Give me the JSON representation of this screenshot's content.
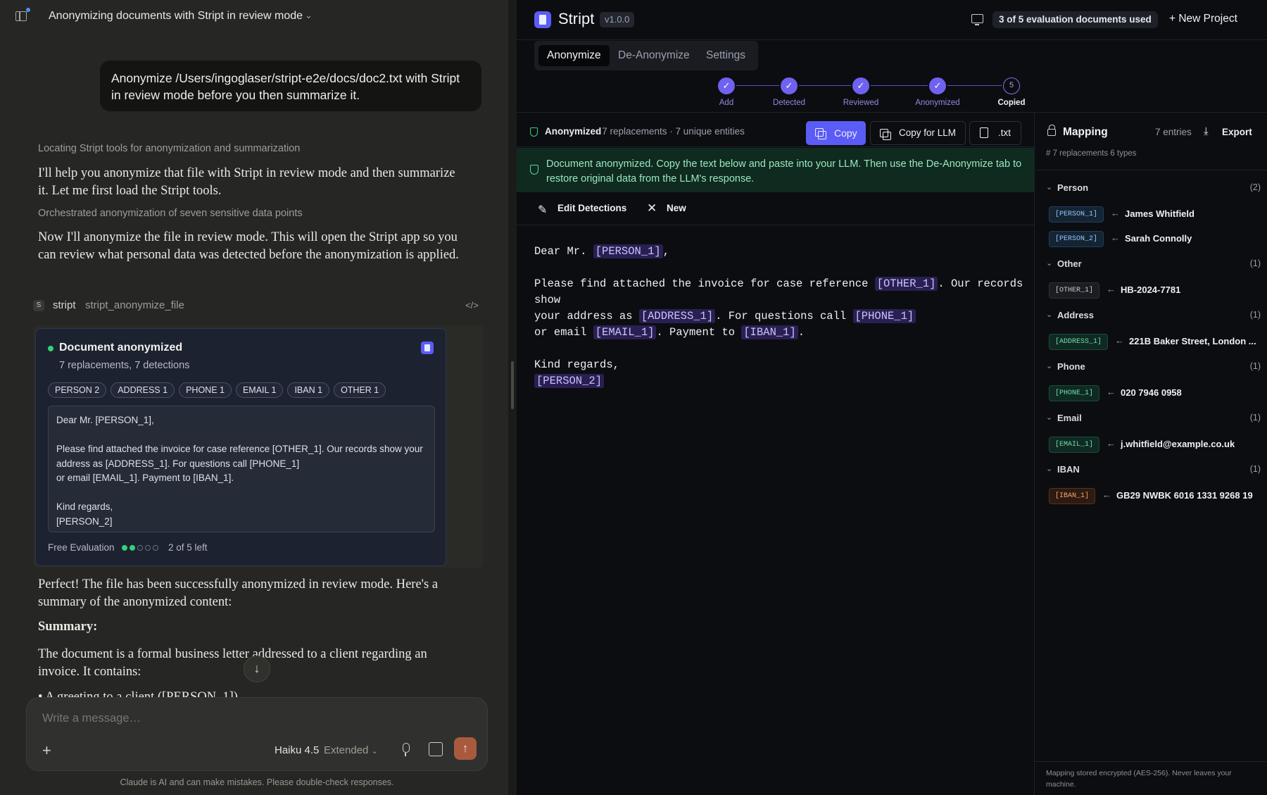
{
  "chat": {
    "title": "Anonymizing documents with Stript in review mode",
    "user_message": "Anonymize /Users/ingoglaser/stript-e2e/docs/doc2.txt with Stript in review mode before you then summarize it.",
    "meta1": "Locating Stript tools for anonymization and summarization",
    "para1": "I'll help you anonymize that file with Stript in review mode and then summarize it. Let me first load the Stript tools.",
    "meta2": "Orchestrated anonymization of seven sensitive data points",
    "para2": "Now I'll anonymize the file in review mode. This will open the Stript app so you can review what personal data was detected before the anonymization is applied.",
    "tool": {
      "badge": "S",
      "name": "stript",
      "function": "stript_anonymize_file",
      "code_icon": "</>"
    },
    "card": {
      "title": "Document anonymized",
      "subtitle": "7 replacements, 7 detections",
      "chips": [
        "PERSON 2",
        "ADDRESS 1",
        "PHONE 1",
        "EMAIL 1",
        "IBAN 1",
        "OTHER 1"
      ],
      "body": "Dear Mr. [PERSON_1],\n\nPlease find attached the invoice for case reference [OTHER_1]. Our records show your address as [ADDRESS_1]. For questions call [PHONE_1]\nor email [EMAIL_1]. Payment to [IBAN_1].\n\nKind regards,\n[PERSON_2]",
      "footer_label": "Free Evaluation",
      "used": 2,
      "total": 5,
      "left_text": "2 of 5 left"
    },
    "para3": "Perfect! The file has been successfully anonymized in review mode. Here's a summary of the anonymized content:",
    "summary_heading": "Summary:",
    "para4": "The document is a formal business letter addressed to a client regarding an invoice. It contains:",
    "partial_line": "• A greeting to a client ([PERSON_1])",
    "composer": {
      "placeholder": "Write a message…",
      "model": "Haiku 4.5",
      "mode": "Extended"
    },
    "disclaimer": "Claude is AI and can make mistakes. Please double-check responses."
  },
  "app": {
    "brand": "Stript",
    "version": "v1.0.0",
    "eval_pill": "3 of 5 evaluation documents used",
    "new_project": "New Project",
    "tabs": [
      "Anonymize",
      "De-Anonymize",
      "Settings"
    ],
    "steps": [
      {
        "label": "Add",
        "glyph": "✓"
      },
      {
        "label": "Detected",
        "glyph": "✓"
      },
      {
        "label": "Reviewed",
        "glyph": "✓"
      },
      {
        "label": "Anonymized",
        "glyph": "✓"
      },
      {
        "label": "Copied",
        "glyph": "5"
      }
    ],
    "status": "Anonymized",
    "status_meta": "·  7 replacements  ·  7 unique entities",
    "btn_copy": "Copy",
    "btn_copy_llm": "Copy for LLM",
    "btn_txt": ".txt",
    "notice": "Document anonymized. Copy the text below and paste into your LLM. Then use the De-Anonymize tab to restore original data from the LLM's response.",
    "edit_label": "Edit Detections",
    "new_label": "New",
    "doc": {
      "l1a": "Dear Mr. ",
      "t1": "[PERSON_1]",
      "l1b": ",",
      "l2a": "Please find attached the invoice for case reference ",
      "t2": "[OTHER_1]",
      "l2b": ". Our records",
      "l3": "show",
      "l4a": "your address as ",
      "t3": "[ADDRESS_1]",
      "l4b": ". For questions call ",
      "t4": "[PHONE_1]",
      "l5a": "or email ",
      "t5": "[EMAIL_1]",
      "l5b": ". Payment to ",
      "t6": "[IBAN_1]",
      "l5c": ".",
      "l6": "Kind regards,",
      "t7": "[PERSON_2]"
    },
    "mapping": {
      "title": "Mapping",
      "count": "7 entries",
      "export": "Export",
      "sub": "# 7 replacements    6 types",
      "groups": [
        {
          "name": "Person",
          "count": "(2)",
          "kind": "person",
          "entries": [
            {
              "token": "[PERSON_1]",
              "value": "James Whitfield"
            },
            {
              "token": "[PERSON_2]",
              "value": "Sarah Connolly"
            }
          ]
        },
        {
          "name": "Other",
          "count": "(1)",
          "kind": "other",
          "entries": [
            {
              "token": "[OTHER_1]",
              "value": "HB-2024-7781"
            }
          ]
        },
        {
          "name": "Address",
          "count": "(1)",
          "kind": "address",
          "entries": [
            {
              "token": "[ADDRESS_1]",
              "value": "221B Baker Street, London ..."
            }
          ]
        },
        {
          "name": "Phone",
          "count": "(1)",
          "kind": "phone",
          "entries": [
            {
              "token": "[PHONE_1]",
              "value": "020 7946 0958"
            }
          ]
        },
        {
          "name": "Email",
          "count": "(1)",
          "kind": "email",
          "entries": [
            {
              "token": "[EMAIL_1]",
              "value": "j.whitfield@example.co.uk"
            }
          ]
        },
        {
          "name": "IBAN",
          "count": "(1)",
          "kind": "iban",
          "entries": [
            {
              "token": "[IBAN_1]",
              "value": "GB29 NWBK 6016 1331 9268 19"
            }
          ]
        }
      ],
      "footer": "Mapping stored encrypted (AES-256). Never leaves your machine."
    },
    "colors": {
      "accent": "#5b5cf6",
      "success": "#34d17a",
      "send": "#a95a3e"
    }
  }
}
